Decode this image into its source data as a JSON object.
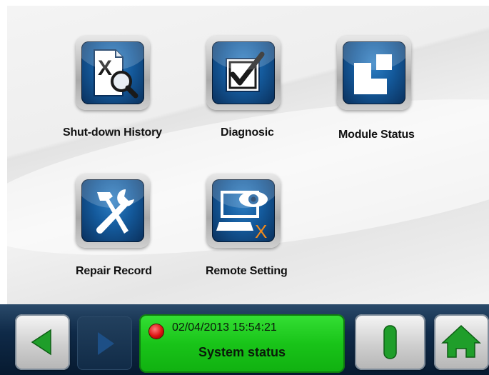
{
  "tiles": [
    {
      "id": "shutdown",
      "label": "Shut-down History",
      "icon": "shutdown-history-icon"
    },
    {
      "id": "diagnosic",
      "label": "Diagnosic",
      "icon": "checkbox-check-icon"
    },
    {
      "id": "module",
      "label": "Module Status",
      "icon": "module-status-icon"
    },
    {
      "id": "repair",
      "label": "Repair Record",
      "icon": "hammer-wrench-icon"
    },
    {
      "id": "remote",
      "label": "Remote Setting",
      "icon": "remote-monitor-eye-icon"
    }
  ],
  "status_panel": {
    "datetime": "02/04/2013  15:54:21",
    "label": "System status",
    "indicator_color": "#dd1111",
    "background_color": "#1ec81e"
  },
  "nav": {
    "back_icon": "triangle-left-icon",
    "forward_icon": "triangle-right-icon",
    "power_icon": "power-bar-icon",
    "home_icon": "home-icon"
  },
  "colors": {
    "accent_green": "#1f9e2a",
    "icon_blue": "#145a9c",
    "bar_background": "#0f2a48"
  }
}
